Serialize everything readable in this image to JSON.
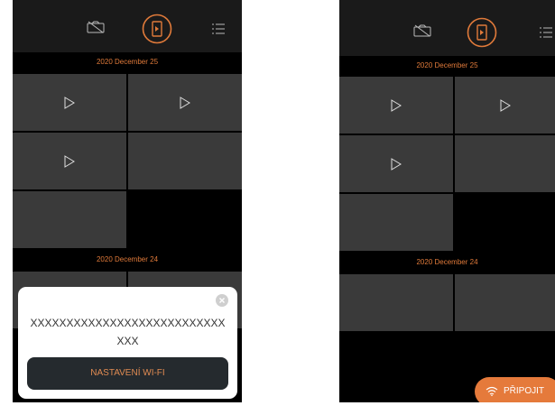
{
  "colors": {
    "accent": "#e07a3a",
    "tile": "#3a3a3a",
    "topbar": "#1a1a1a"
  },
  "icons": [
    "camera-off-icon",
    "door-icon",
    "list-icon",
    "play-icon",
    "wifi-icon",
    "close-icon"
  ],
  "screen_left": {
    "sections": [
      {
        "date": "2020 December 25"
      },
      {
        "date": "2020 December 24"
      }
    ],
    "dialog": {
      "message": "XXXXXXXXXXXXXXXXXXXXXXXXXXXXXX",
      "button_label": "NASTAVENÍ WI-FI"
    }
  },
  "screen_right": {
    "sections": [
      {
        "date": "2020 December 25"
      },
      {
        "date": "2020 December 24"
      }
    ],
    "connect_label": "PŘIPOJIT"
  }
}
